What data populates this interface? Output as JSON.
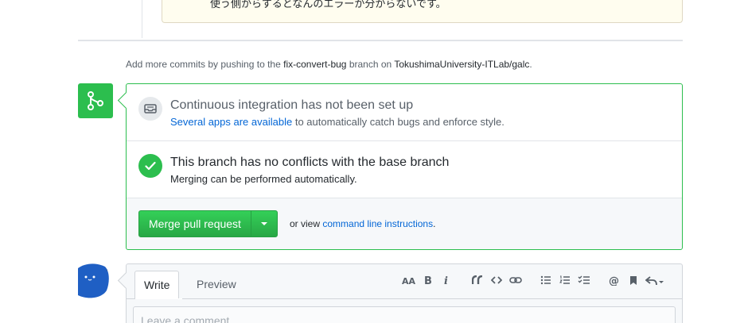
{
  "previous_comment": {
    "text": "使う側からするとなんのエラーか分からないです。"
  },
  "push_hint": {
    "prefix": "Add more commits by pushing to the",
    "branch": "fix-convert-bug",
    "middle": "branch on",
    "repo": "TokushimaUniversity-ITLab/galc",
    "suffix": "."
  },
  "ci": {
    "title": "Continuous integration has not been set up",
    "link": "Several apps are available",
    "rest": "to automatically catch bugs and enforce style."
  },
  "conflicts": {
    "title": "This branch has no conflicts with the base branch",
    "subtitle": "Merging can be performed automatically."
  },
  "merge": {
    "button_label": "Merge pull request",
    "or_view": "or view",
    "cli_link": "command line instructions",
    "suffix": "."
  },
  "editor": {
    "tab_write": "Write",
    "tab_preview": "Preview",
    "placeholder": "Leave a comment",
    "toolbar": [
      "header-icon",
      "bold-icon",
      "italic-icon",
      "quote-icon",
      "code-icon",
      "link-icon",
      "bulleted-list-icon",
      "numbered-list-icon",
      "task-list-icon",
      "mention-icon",
      "reference-icon",
      "reply-icon"
    ]
  },
  "colors": {
    "success": "#2cbe4e",
    "link": "#0366d6",
    "border": "#e1e4e8"
  }
}
